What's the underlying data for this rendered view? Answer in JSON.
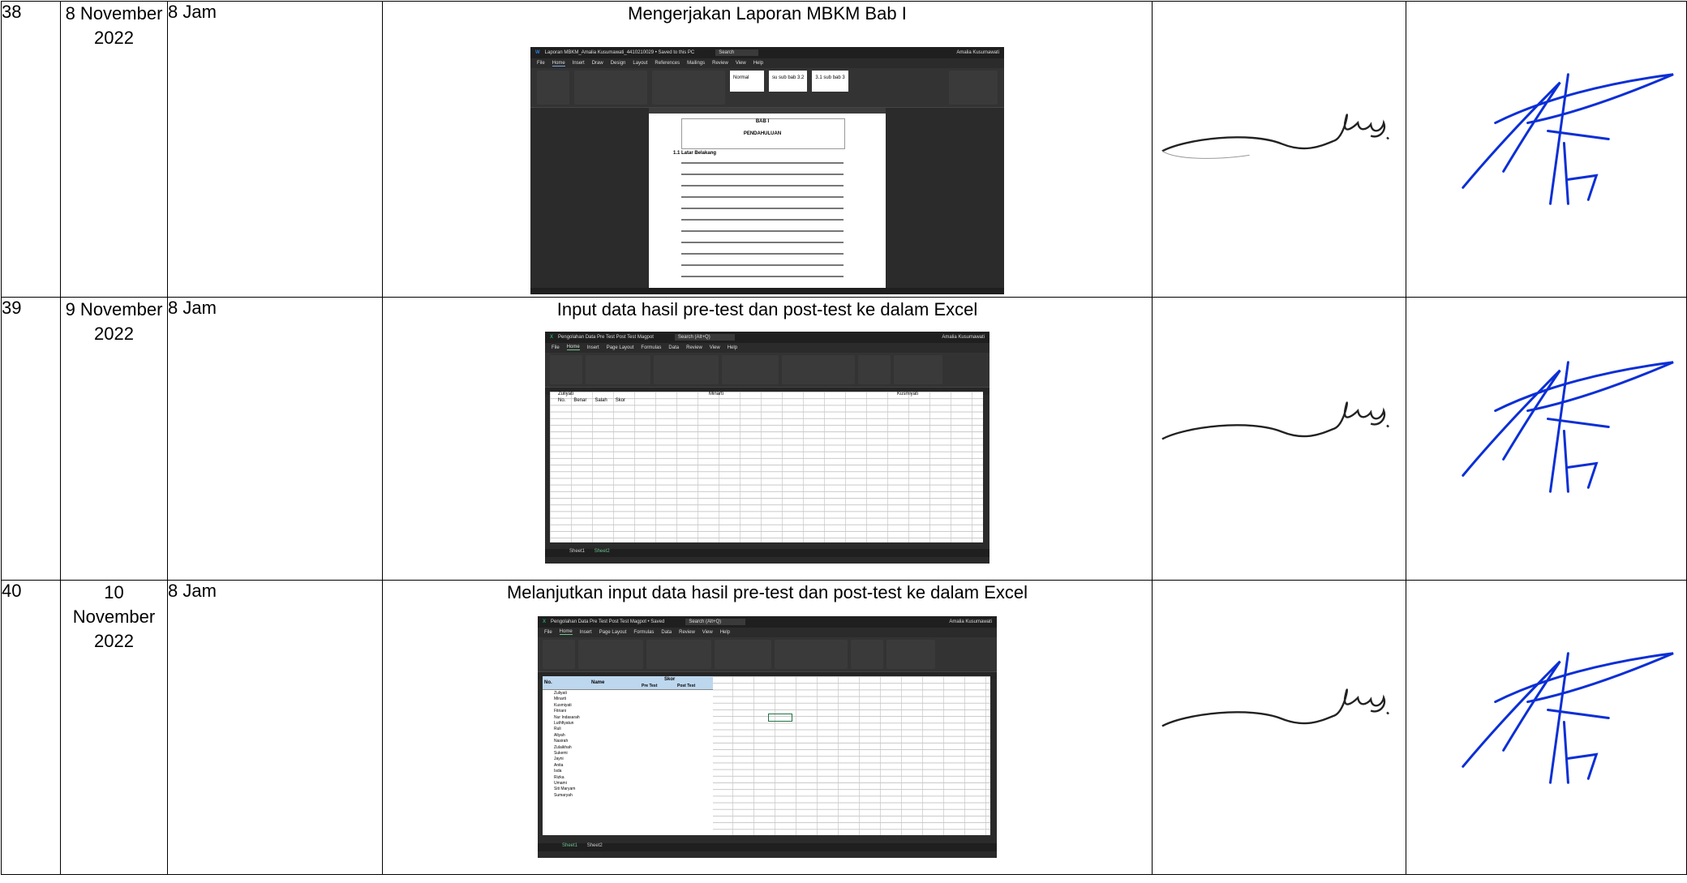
{
  "rows": [
    {
      "no": "38",
      "date": "8 November 2022",
      "duration": "8 Jam",
      "activity": "Mengerjakan Laporan MBKM Bab I",
      "screenshot": {
        "app": "Word",
        "window_title": "Laporan MBKM_Amalia Kusumawati_4410210029 • Saved to this PC",
        "search": "Search",
        "user": "Amalia Kusumawati",
        "menu": [
          "File",
          "Home",
          "Insert",
          "Draw",
          "Design",
          "Layout",
          "References",
          "Mailings",
          "Review",
          "View",
          "Help"
        ],
        "styles": [
          "Normal",
          "su sub bab 3.2",
          "3.1  sub bab 3"
        ],
        "doc_heading": "BAB I",
        "doc_subheading": "PENDAHULUAN",
        "doc_section": "1.1     Latar Belakang"
      },
      "signature_1": "handwritten-signature",
      "signature_2": "handwritten-signature"
    },
    {
      "no": "39",
      "date": "9 November 2022",
      "duration": "8 Jam",
      "activity": "Input data hasil pre-test dan post-test ke dalam Excel",
      "screenshot": {
        "app": "Excel",
        "window_title": "Pengolahan Data Pre Test Post Test Magpot",
        "search": "Search (Alt+Q)",
        "user": "Amalia Kusumawati",
        "menu": [
          "File",
          "Home",
          "Insert",
          "Page Layout",
          "Formulas",
          "Data",
          "Review",
          "View",
          "Help"
        ],
        "sheets": [
          "Sheet1",
          "Sheet2"
        ],
        "headers": [
          "No.",
          "Benar",
          "Salah",
          "Skor"
        ],
        "names": [
          "Zuliyati",
          "Minarti",
          "Kusmiyati"
        ]
      },
      "signature_1": "handwritten-signature",
      "signature_2": "handwritten-signature"
    },
    {
      "no": "40",
      "date": "10 November 2022",
      "duration": "8 Jam",
      "activity": "Melanjutkan input data hasil pre-test dan post-test ke dalam Excel",
      "screenshot": {
        "app": "Excel",
        "window_title": "Pengolahan Data Pre Test Post Test Magpot • Saved",
        "search": "Search (Alt+Q)",
        "user": "Amalia Kusumawati",
        "menu": [
          "File",
          "Home",
          "Insert",
          "Page Layout",
          "Formulas",
          "Data",
          "Review",
          "View",
          "Help"
        ],
        "sheets": [
          "Sheet1",
          "Sheet2"
        ],
        "headers": [
          "No.",
          "Name",
          "Skor",
          "Pre Test",
          "Post Test"
        ],
        "names": [
          "Zuliyati",
          "Minarti",
          "Kusmiyati",
          "Fitriani",
          "Nur Indasarah",
          "Luthfiyatun",
          "Ruli",
          "Aliyah",
          "Nasirah",
          "Zulaikhah",
          "Sukemi",
          "Jayni",
          "Anita",
          "Isda",
          "Rizka",
          "Umami",
          "Siti Maryam",
          "Sumaryah"
        ]
      },
      "signature_1": "handwritten-signature",
      "signature_2": "handwritten-signature"
    }
  ]
}
